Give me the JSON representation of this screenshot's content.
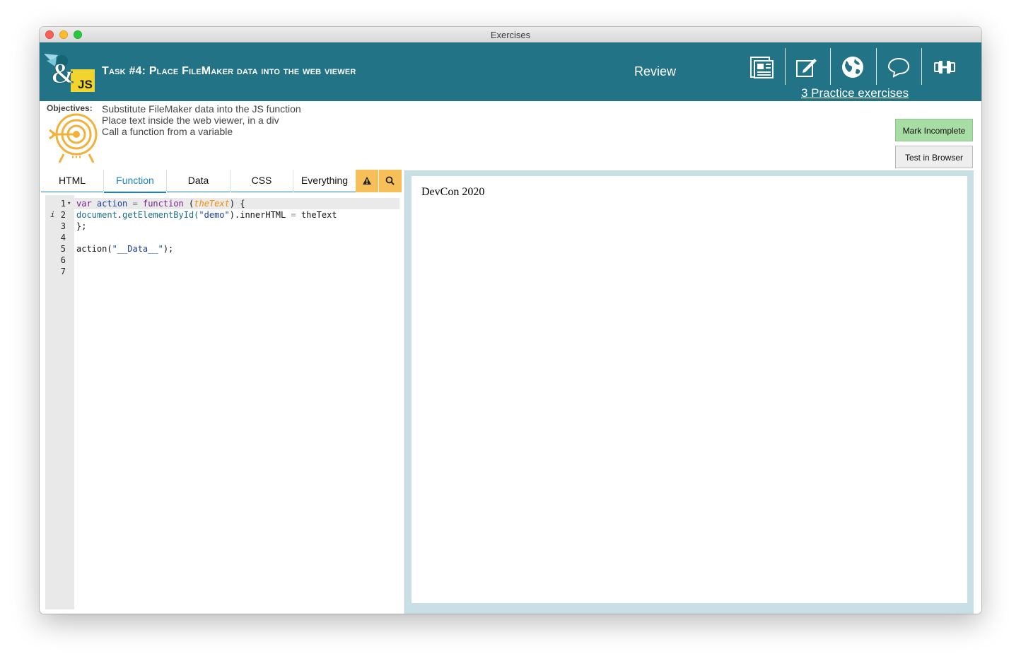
{
  "window": {
    "title": "Exercises"
  },
  "header": {
    "task_title": "Task #4: Place FileMaker data into the web viewer",
    "review_label": "Review",
    "practice_link": "3 Practice exercises",
    "logo_text": "&JS",
    "icons": [
      "document-icon",
      "edit-icon",
      "globe-icon",
      "chat-icon",
      "dumbbell-icon"
    ],
    "background_color": "#227386"
  },
  "objectives": {
    "label": "Objectives:",
    "items": [
      "Substitute FileMaker data into the JS function",
      "Place text inside the web viewer, in a div",
      "Call a function from a variable"
    ]
  },
  "buttons": {
    "mark_incomplete": "Mark Incomplete",
    "test_in_browser": "Test in Browser"
  },
  "tabs": {
    "items": [
      "HTML",
      "Function",
      "Data",
      "CSS",
      "Everything"
    ],
    "active": "Function",
    "icons": [
      "warning-icon",
      "search-icon"
    ],
    "accent_color": "#1a82c4",
    "icon_bg": "#f6bf57"
  },
  "editor": {
    "line_numbers": [
      "1",
      "2",
      "3",
      "4",
      "5",
      "6",
      "7"
    ],
    "fold_marker": "▾",
    "info_marker": "i",
    "lines": {
      "l1": {
        "kw_var": "var",
        "name": "action",
        "eq": "=",
        "kw_function": "function",
        "open": "(",
        "param": "theText",
        "close": ") {"
      },
      "l2": {
        "obj": "document",
        "dot": ".",
        "method": "getElementById(",
        "arg": "\"demo\"",
        "rest": ").innerHTML",
        "eq": "=",
        "value": "theText"
      },
      "l3": "};",
      "l5": {
        "call": "action(",
        "arg": "\"__Data__\"",
        "end": ");"
      }
    }
  },
  "viewer": {
    "content": "DevCon 2020"
  }
}
